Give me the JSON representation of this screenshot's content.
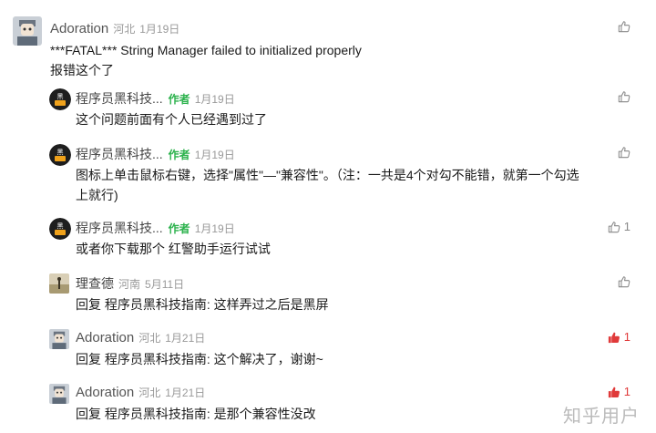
{
  "comments": [
    {
      "author": "Adoration",
      "location": "河北",
      "date": "1月19日",
      "is_author": false,
      "body_lines": [
        "***FATAL*** String Manager failed to initialized properly",
        "报错这个了"
      ],
      "likes": "",
      "liked": false,
      "avatar": "person-avatar"
    },
    {
      "author": "程序员黑科技...",
      "author_tag": "作者",
      "date": "1月19日",
      "is_author": true,
      "body_lines": [
        "这个问题前面有个人已经遇到过了"
      ],
      "likes": "",
      "liked": false,
      "avatar": "brand-avatar"
    },
    {
      "author": "程序员黑科技...",
      "author_tag": "作者",
      "date": "1月19日",
      "is_author": true,
      "body_lines": [
        "图标上单击鼠标右键，选择\"属性\"—\"兼容性\"。（注：一共是4个对勾不能错，就第一个勾选",
        "上就行)"
      ],
      "likes": "",
      "liked": false,
      "avatar": "brand-avatar"
    },
    {
      "author": "程序员黑科技...",
      "author_tag": "作者",
      "date": "1月19日",
      "is_author": true,
      "body_lines": [
        "或者你下载那个 红警助手运行试试"
      ],
      "likes": "1",
      "liked": false,
      "avatar": "brand-avatar"
    },
    {
      "author": "理查德",
      "location": "河南",
      "date": "5月11日",
      "is_author": false,
      "reply_keyword": "回复",
      "reply_to": "程序员黑科技指南",
      "reply_text": ": 这样弄过之后是黑屏",
      "likes": "",
      "liked": false,
      "avatar": "landscape-avatar"
    },
    {
      "author": "Adoration",
      "location": "河北",
      "date": "1月21日",
      "is_author": false,
      "reply_keyword": "回复",
      "reply_to": "程序员黑科技指南",
      "reply_text": ": 这个解决了，谢谢~",
      "likes": "1",
      "liked": true,
      "avatar": "person-avatar"
    },
    {
      "author": "Adoration",
      "location": "河北",
      "date": "1月21日",
      "is_author": false,
      "reply_keyword": "回复",
      "reply_to": "程序员黑科技指南",
      "reply_text": ": 是那个兼容性没改",
      "likes": "1",
      "liked": true,
      "avatar": "person-avatar"
    }
  ],
  "watermark": "知乎用户",
  "colors": {
    "author_tag": "#2bb24c",
    "liked": "#e03a3a",
    "meta": "#999999"
  }
}
